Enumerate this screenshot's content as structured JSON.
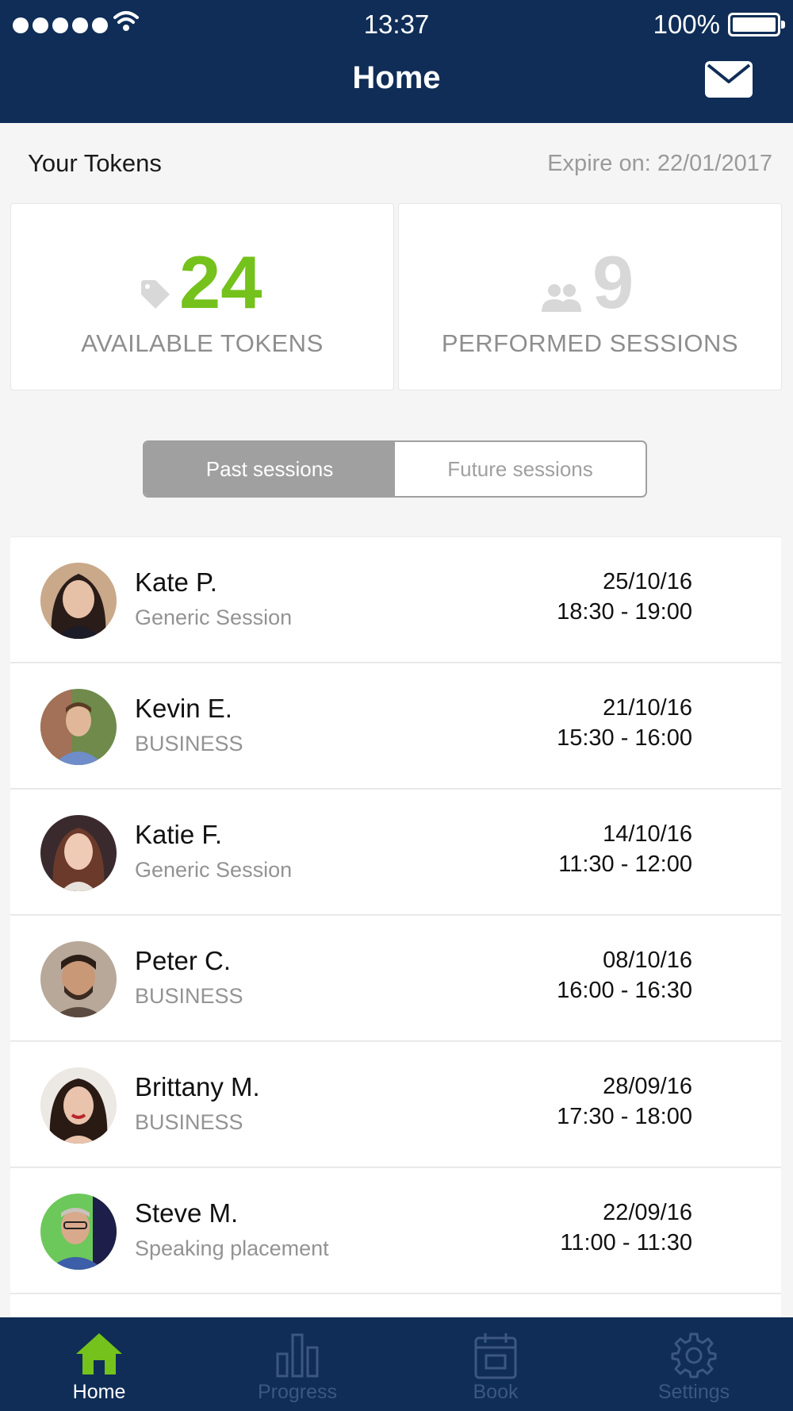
{
  "status_bar": {
    "time": "13:37",
    "battery": "100%"
  },
  "nav": {
    "title": "Home"
  },
  "tokens": {
    "label": "Your Tokens",
    "expire": "Expire on: 22/01/2017",
    "available": {
      "value": "24",
      "caption": "AVAILABLE TOKENS"
    },
    "performed": {
      "value": "9",
      "caption": "PERFORMED SESSIONS"
    }
  },
  "segment": {
    "past": "Past sessions",
    "future": "Future sessions",
    "selected": "past"
  },
  "sessions": [
    {
      "name": "Kate P.",
      "type": "Generic Session",
      "date": "25/10/16",
      "time": "18:30 - 19:00"
    },
    {
      "name": "Kevin E.",
      "type": "BUSINESS",
      "date": "21/10/16",
      "time": "15:30 - 16:00"
    },
    {
      "name": "Katie F.",
      "type": "Generic Session",
      "date": "14/10/16",
      "time": "11:30 - 12:00"
    },
    {
      "name": "Peter C.",
      "type": "BUSINESS",
      "date": "08/10/16",
      "time": "16:00 - 16:30"
    },
    {
      "name": "Brittany M.",
      "type": "BUSINESS",
      "date": "28/09/16",
      "time": "17:30 - 18:00"
    },
    {
      "name": "Steve M.",
      "type": "Speaking placement",
      "date": "22/09/16",
      "time": "11:00 - 11:30"
    }
  ],
  "tabs": [
    {
      "label": "Home",
      "icon": "home-icon",
      "active": true
    },
    {
      "label": "Progress",
      "icon": "bar-chart-icon",
      "active": false
    },
    {
      "label": "Book",
      "icon": "calendar-icon",
      "active": false
    },
    {
      "label": "Settings",
      "icon": "gear-icon",
      "active": false
    }
  ],
  "colors": {
    "navy": "#0f2d57",
    "green": "#74c21b",
    "gray": "#a0a0a0"
  }
}
